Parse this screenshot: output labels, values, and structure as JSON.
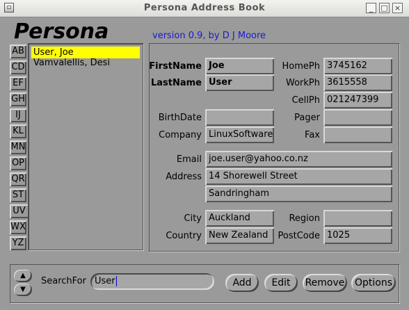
{
  "window": {
    "title": "Persona Address Book",
    "minimize": "_",
    "maximize": "□",
    "close": "×"
  },
  "app": {
    "logo": "Persona",
    "version": "version 0.9, by D J Moore"
  },
  "tabs": [
    "AB",
    "CD",
    "EF",
    "GH",
    "IJ",
    "KL",
    "MN",
    "OP",
    "QR",
    "ST",
    "UV",
    "WX",
    "YZ"
  ],
  "list": {
    "items": [
      "User, Joe",
      "Vamvalellis, Desi"
    ],
    "selected": 0
  },
  "labels": {
    "firstname": "FirstName",
    "lastname": "LastName",
    "birthdate": "BirthDate",
    "company": "Company",
    "homeph": "HomePh",
    "workph": "WorkPh",
    "cellph": "CellPh",
    "pager": "Pager",
    "fax": "Fax",
    "email": "Email",
    "address": "Address",
    "city": "City",
    "region": "Region",
    "country": "Country",
    "postcode": "PostCode"
  },
  "fields": {
    "firstname": "Joe",
    "lastname": "User",
    "birthdate": "",
    "company": "LinuxSoftware",
    "homeph": "3745162",
    "workph": "3615558",
    "cellph": "021247399",
    "pager": "",
    "fax": "",
    "email": "joe.user@yahoo.co.nz",
    "address1": "14 Shorewell Street",
    "address2": "Sandringham",
    "city": "Auckland",
    "region": "",
    "country": "New Zealand",
    "postcode": "1025"
  },
  "search": {
    "label": "SearchFor",
    "value": "User"
  },
  "buttons": {
    "add": "Add",
    "edit": "Edit",
    "remove": "Remove",
    "options": "Options"
  },
  "arrows": {
    "up": "▲",
    "down": "▼"
  }
}
